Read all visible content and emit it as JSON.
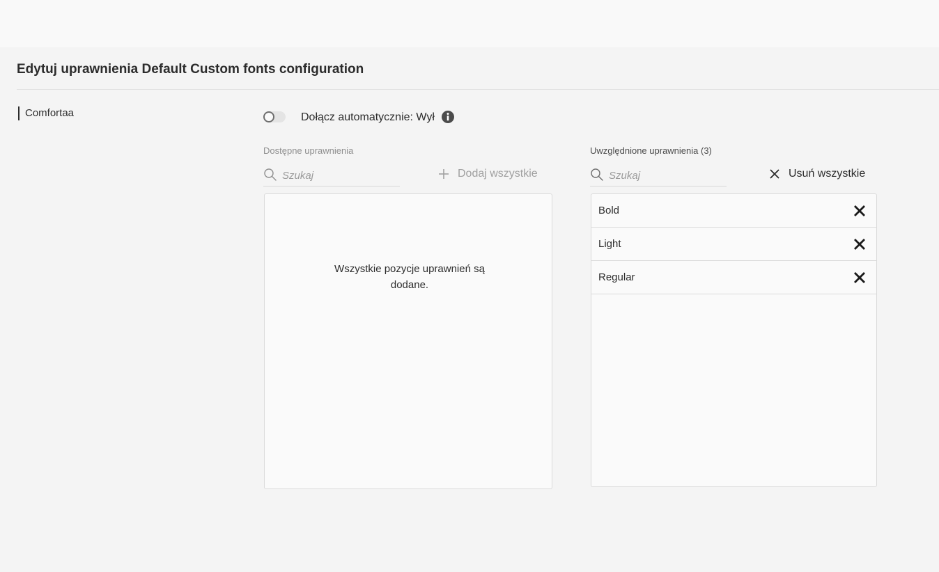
{
  "page": {
    "title": "Edytuj uprawnienia Default Custom fonts configuration"
  },
  "sidebar": {
    "items": [
      {
        "label": "Comfortaa",
        "selected": true
      }
    ]
  },
  "auto_include": {
    "label": "Dołącz automatycznie: Wył",
    "enabled": false
  },
  "available": {
    "label": "Dostępne uprawnienia",
    "search_placeholder": "Szukaj",
    "add_all_label": "Dodaj wszystkie",
    "empty_message": "Wszystkie pozycje uprawnień są dodane."
  },
  "included": {
    "label": "Uwzględnione uprawnienia (3)",
    "search_placeholder": "Szukaj",
    "remove_all_label": "Usuń wszystkie",
    "items": [
      {
        "label": "Bold"
      },
      {
        "label": "Light"
      },
      {
        "label": "Regular"
      }
    ]
  },
  "icons": {
    "info": "info-icon",
    "search": "search-icon",
    "add": "plus-icon",
    "remove": "close-icon"
  },
  "colors": {
    "background": "#f4f4f4",
    "topbar": "#f9f9f9",
    "text": "#2c2c2c",
    "muted": "#8e8e8e",
    "panel": "#fafafa",
    "border": "#dadada"
  }
}
